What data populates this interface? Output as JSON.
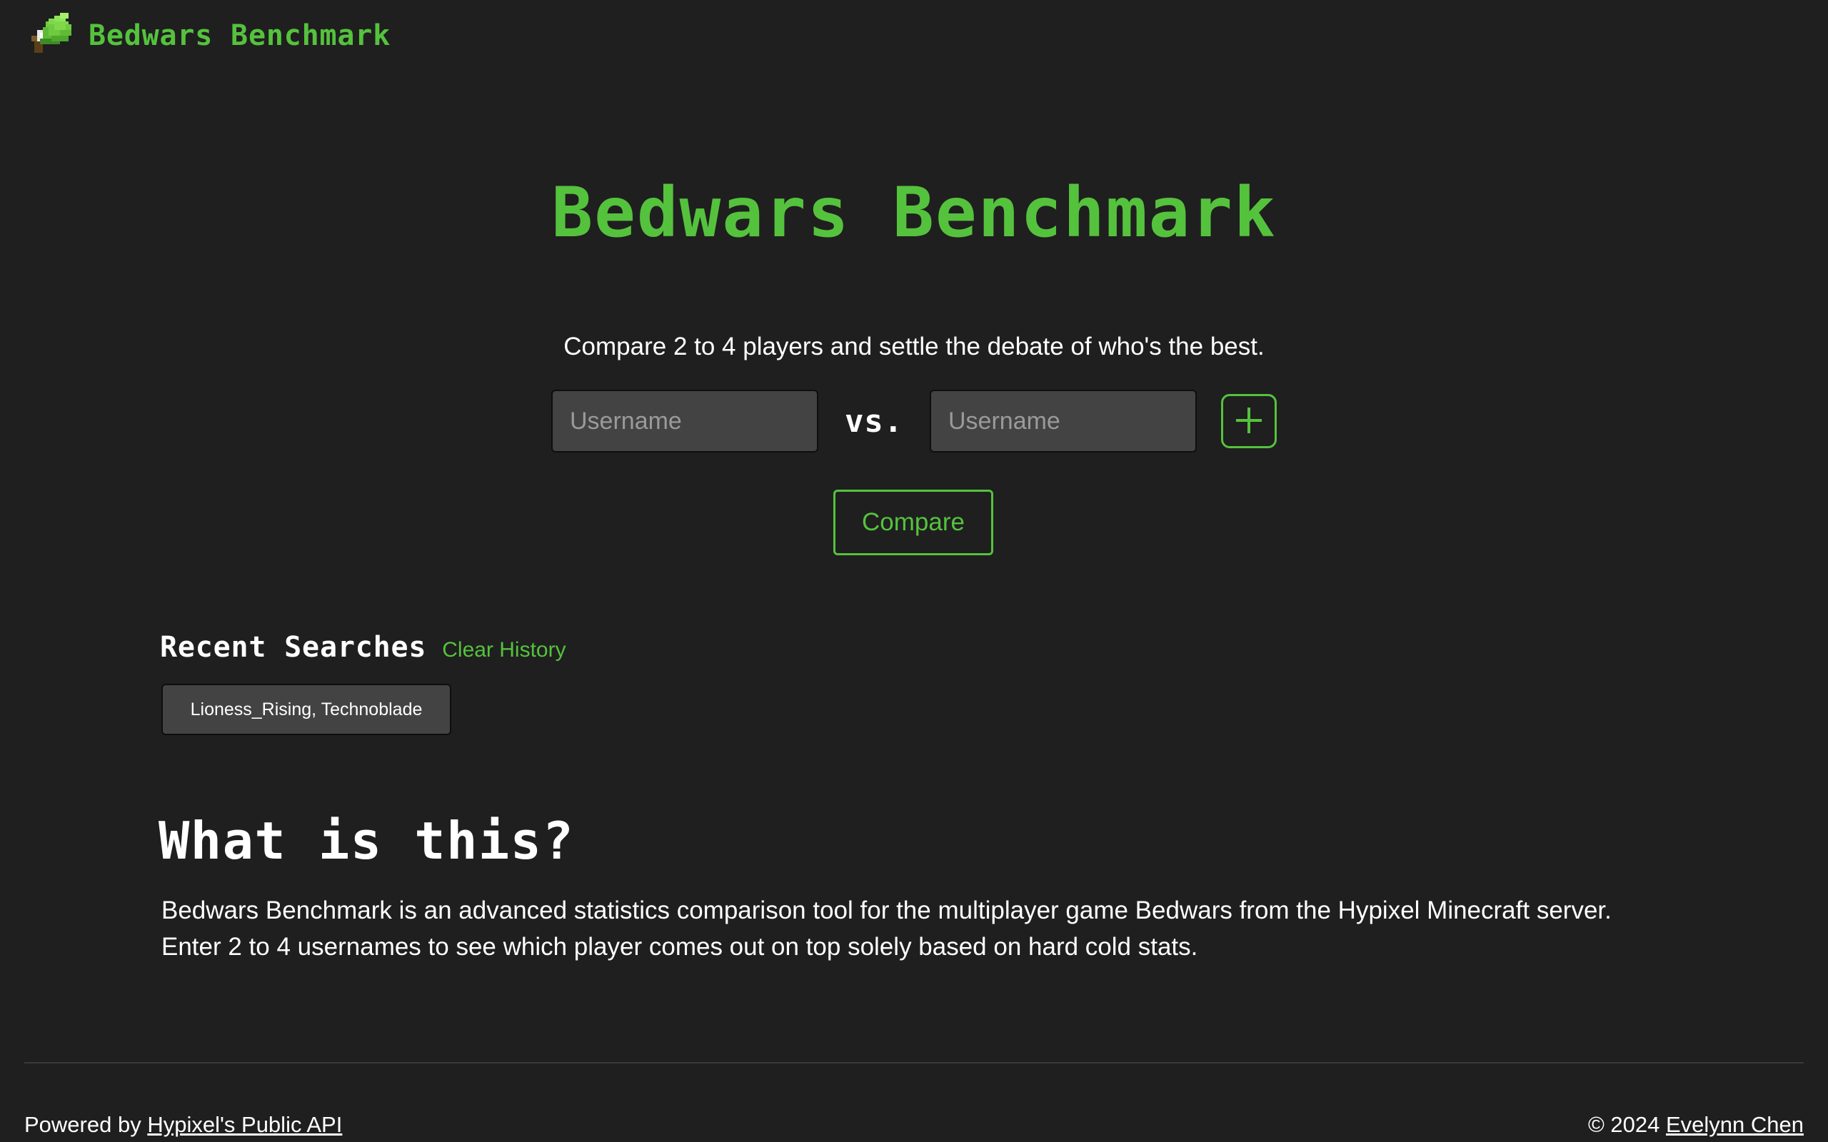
{
  "header": {
    "brand": "Bedwars Benchmark",
    "logo_icon": "minecraft-bed-icon"
  },
  "hero": {
    "title": "Bedwars Benchmark",
    "tagline": "Compare 2 to 4 players and settle the debate of who's the best."
  },
  "compare_form": {
    "player1": {
      "value": "",
      "placeholder": "Username"
    },
    "player2": {
      "value": "",
      "placeholder": "Username"
    },
    "vs_label": "vs.",
    "add_icon": "plus-icon",
    "compare_label": "Compare"
  },
  "recent": {
    "title": "Recent Searches",
    "clear_label": "Clear History",
    "items": [
      "Lioness_Rising, Technoblade"
    ]
  },
  "about": {
    "title": "What is this?",
    "line1": "Bedwars Benchmark is an advanced statistics comparison tool for the multiplayer game Bedwars from the Hypixel Minecraft server.",
    "line2": "Enter 2 to 4 usernames to see which player comes out on top solely based on hard cold stats."
  },
  "footer": {
    "powered_prefix": "Powered by",
    "powered_link": "Hypixel's Public API",
    "copyright_prefix": "© 2024",
    "author_link": "Evelynn Chen"
  },
  "colors": {
    "accent": "#55c23d",
    "background": "#1f1f1f",
    "input_bg": "#434343"
  }
}
